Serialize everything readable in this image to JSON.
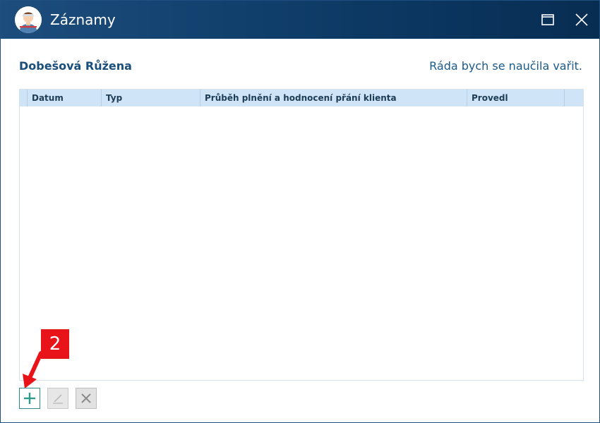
{
  "window": {
    "title": "Záznamy",
    "title_icon": "user-avatar-icon",
    "controls": [
      {
        "name": "maximize",
        "icon": "maximize-icon"
      },
      {
        "name": "close",
        "icon": "close-icon"
      }
    ]
  },
  "client": {
    "name": "Dobešová Růžena",
    "wish": "Ráda bych se naučila vařit."
  },
  "grid": {
    "columns": [
      {
        "key": "datum",
        "label": "Datum"
      },
      {
        "key": "typ",
        "label": "Typ"
      },
      {
        "key": "prubeh",
        "label": "Průběh plnění a hodnocení přání klienta"
      },
      {
        "key": "provedl",
        "label": "Provedl"
      }
    ],
    "rows": []
  },
  "annotation": {
    "label": "2",
    "color": "#e8141a"
  },
  "toolbar": {
    "buttons": [
      {
        "name": "add",
        "icon": "plus-icon",
        "enabled": true
      },
      {
        "name": "edit",
        "icon": "pencil-icon",
        "enabled": false
      },
      {
        "name": "delete",
        "icon": "x-icon",
        "enabled": false
      }
    ]
  },
  "colors": {
    "titlebar": "#0c3964",
    "accent": "#1a4f7c",
    "header_bg": "#cfe4f6",
    "add_green": "#2e9b8b"
  }
}
